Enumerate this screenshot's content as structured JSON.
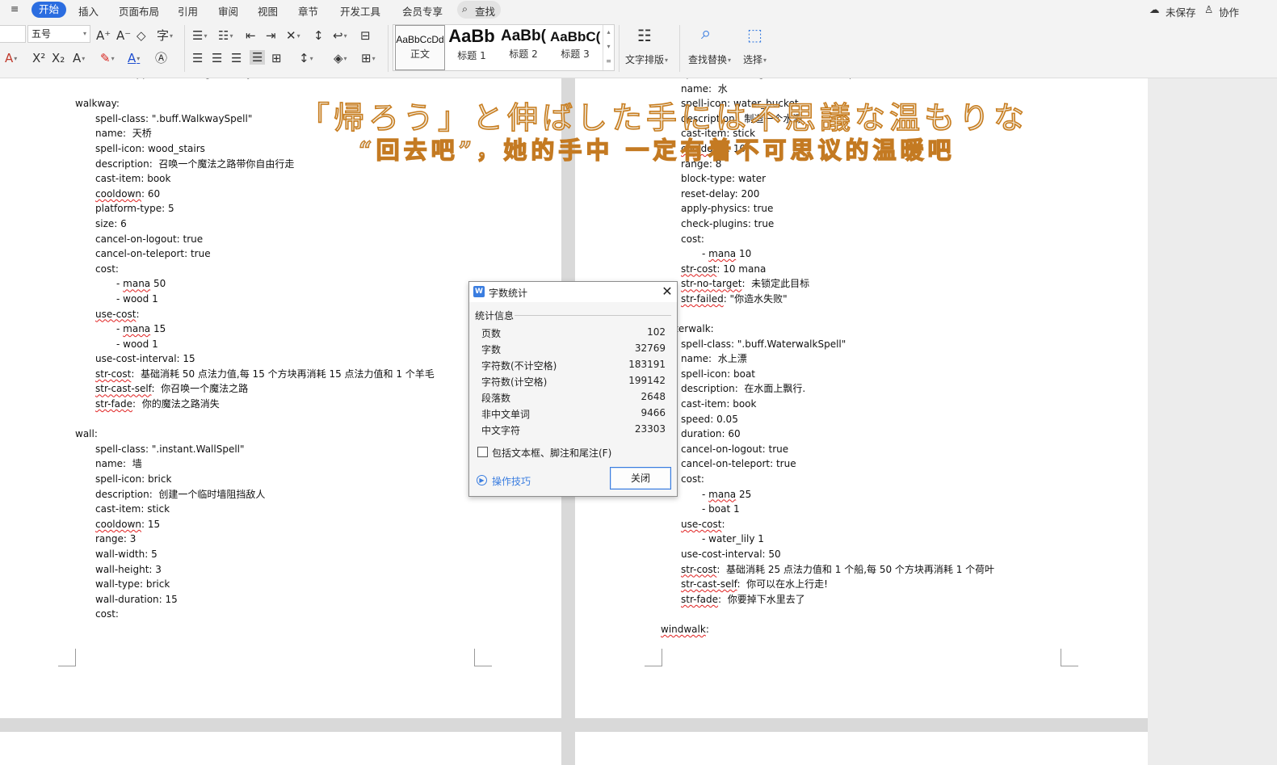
{
  "menubar": {
    "menu_label": "≡",
    "tabs": [
      "开始",
      "插入",
      "页面布局",
      "引用",
      "审阅",
      "视图",
      "章节",
      "开发工具",
      "会员专享"
    ],
    "search": "查找",
    "unsaved": "未保存",
    "collab": "协作"
  },
  "ribbon": {
    "font_size": "五号",
    "styles": [
      {
        "preview": "AaBbCcDd",
        "name": "正文"
      },
      {
        "preview": "AaBb",
        "name": "标题 1"
      },
      {
        "preview": "AaBb(",
        "name": "标题 2"
      },
      {
        "preview": "AaBbC(",
        "name": "标题 3"
      }
    ],
    "text_layout": "文字排版",
    "find_replace": "查找替换",
    "select": "选择"
  },
  "subtitle": {
    "jp": "「帰ろう」と伸ばした手には不思議な温もりな",
    "cn": "“回去吧”，她的手中  一定有着不可思议的温暖吧"
  },
  "doc_left": [
    {
      "t": "disappear-with-target-entity: true",
      "i": 2
    },
    {
      "t": "",
      "i": 0
    },
    {
      "t": "walkway:",
      "i": 0
    },
    {
      "t": "spell-class: \".buff.WalkwaySpell\"",
      "i": 1
    },
    {
      "t": "name:  天桥",
      "i": 1
    },
    {
      "t": "spell-icon: wood_stairs",
      "i": 1
    },
    {
      "t": "description:  召唤一个魔法之路带你自由行走",
      "i": 1
    },
    {
      "t": "cast-item: book",
      "i": 1
    },
    {
      "t": "cooldown: 60",
      "i": 1
    },
    {
      "t": "platform-type: 5",
      "i": 1
    },
    {
      "t": "size: 6",
      "i": 1
    },
    {
      "t": "cancel-on-logout: true",
      "i": 1
    },
    {
      "t": "cancel-on-teleport: true",
      "i": 1
    },
    {
      "t": "cost:",
      "i": 1
    },
    {
      "t": "- mana 50",
      "i": 2
    },
    {
      "t": "- wood 1",
      "i": 2
    },
    {
      "t": "use-cost:",
      "i": 1
    },
    {
      "t": "- mana 15",
      "i": 2
    },
    {
      "t": "- wood 1",
      "i": 2
    },
    {
      "t": "use-cost-interval: 15",
      "i": 1
    },
    {
      "t": "str-cost:  基础消耗 50 点法力值,每 15 个方块再消耗 15 点法力值和 1 个羊毛",
      "i": 1
    },
    {
      "t": "str-cast-self:  你召唤一个魔法之路",
      "i": 1
    },
    {
      "t": "str-fade:  你的魔法之路消失",
      "i": 1
    },
    {
      "t": "",
      "i": 0
    },
    {
      "t": "wall:",
      "i": 0
    },
    {
      "t": "spell-class: \".instant.WallSpell\"",
      "i": 1
    },
    {
      "t": "name:  墙",
      "i": 1
    },
    {
      "t": "spell-icon: brick",
      "i": 1
    },
    {
      "t": "description:  创建一个临时墙阻挡敌人",
      "i": 1
    },
    {
      "t": "cast-item: stick",
      "i": 1
    },
    {
      "t": "cooldown: 15",
      "i": 1
    },
    {
      "t": "range: 3",
      "i": 1
    },
    {
      "t": "wall-width: 5",
      "i": 1
    },
    {
      "t": "wall-height: 3",
      "i": 1
    },
    {
      "t": "wall-type: brick",
      "i": 1
    },
    {
      "t": "wall-duration: 15",
      "i": 1
    },
    {
      "t": "cost:",
      "i": 1
    }
  ],
  "doc_right": [
    {
      "t": "spell-class: \".targeted.MaterializeSpell\"",
      "i": 1
    },
    {
      "t": "name:  水",
      "i": 1
    },
    {
      "t": "spell-icon: water_bucket",
      "i": 1
    },
    {
      "t": "description:  制造一个水源",
      "i": 1
    },
    {
      "t": "cast-item: stick",
      "i": 1
    },
    {
      "t": "cooldown: 10",
      "i": 1
    },
    {
      "t": "range: 8",
      "i": 1
    },
    {
      "t": "block-type: water",
      "i": 1
    },
    {
      "t": "reset-delay: 200",
      "i": 1
    },
    {
      "t": "apply-physics: true",
      "i": 1
    },
    {
      "t": "check-plugins: true",
      "i": 1
    },
    {
      "t": "cost:",
      "i": 1
    },
    {
      "t": "- mana 10",
      "i": 2
    },
    {
      "t": "str-cost: 10 mana",
      "i": 1
    },
    {
      "t": "str-no-target:  未锁定此目标",
      "i": 1
    },
    {
      "t": "str-failed: \"你造水失败\"",
      "i": 1
    },
    {
      "t": "",
      "i": 0
    },
    {
      "t": "waterwalk:",
      "i": 0
    },
    {
      "t": "spell-class: \".buff.WaterwalkSpell\"",
      "i": 1
    },
    {
      "t": "name:  水上漂",
      "i": 1
    },
    {
      "t": "spell-icon: boat",
      "i": 1
    },
    {
      "t": "description:  在水面上飘行.",
      "i": 1
    },
    {
      "t": "cast-item: book",
      "i": 1
    },
    {
      "t": "speed: 0.05",
      "i": 1
    },
    {
      "t": "duration: 60",
      "i": 1
    },
    {
      "t": "cancel-on-logout: true",
      "i": 1
    },
    {
      "t": "cancel-on-teleport: true",
      "i": 1
    },
    {
      "t": "cost:",
      "i": 1
    },
    {
      "t": "- mana 25",
      "i": 2
    },
    {
      "t": "- boat 1",
      "i": 2
    },
    {
      "t": "use-cost:",
      "i": 1
    },
    {
      "t": "- water_lily 1",
      "i": 2
    },
    {
      "t": "use-cost-interval: 50",
      "i": 1
    },
    {
      "t": "str-cost:  基础消耗 25 点法力值和 1 个船,每 50 个方块再消耗 1 个荷叶",
      "i": 1
    },
    {
      "t": "str-cast-self:  你可以在水上行走!",
      "i": 1
    },
    {
      "t": "str-fade:  你要掉下水里去了",
      "i": 1
    },
    {
      "t": "",
      "i": 0
    },
    {
      "t": "windwalk:",
      "i": 0
    }
  ],
  "dialog": {
    "title": "字数统计",
    "group": "统计信息",
    "stats": [
      {
        "label": "页数",
        "value": "102"
      },
      {
        "label": "字数",
        "value": "32769"
      },
      {
        "label": "字符数(不计空格)",
        "value": "183191"
      },
      {
        "label": "字符数(计空格)",
        "value": "199142"
      },
      {
        "label": "段落数",
        "value": "2648"
      },
      {
        "label": "非中文单词",
        "value": "9466"
      },
      {
        "label": "中文字符",
        "value": "23303"
      }
    ],
    "checkbox_label": "包括文本框、脚注和尾注(F)",
    "tips": "操作技巧",
    "close": "关闭"
  }
}
